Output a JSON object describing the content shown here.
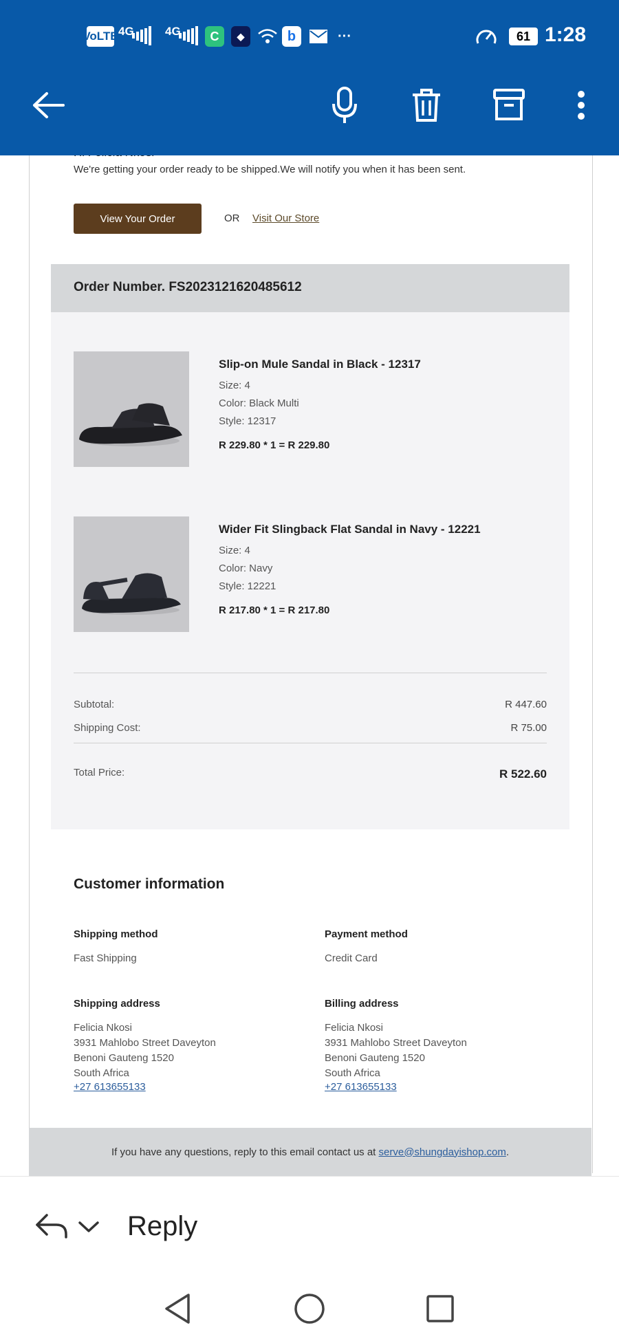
{
  "status_bar": {
    "volte": "VoLTE",
    "net1": "4G",
    "net2": "4G",
    "battery": "61",
    "time": "1:28",
    "more": "···"
  },
  "app_bar": {
    "icons": [
      "back-arrow-icon",
      "microphone-icon",
      "trash-icon",
      "archive-icon",
      "more-vert-icon"
    ],
    "color": "#0859a8"
  },
  "email": {
    "greeting": "Hi Felicia Nkosi",
    "ready_text": "We're getting your order ready to be shipped.We will notify you when it has been sent.",
    "view_order_label": "View Your Order",
    "or_label": "OR",
    "visit_store_label": "Visit Our Store",
    "order_number": "Order Number. FS2023121620485612",
    "products": [
      {
        "title": "Slip-on Mule Sandal in Black - 12317",
        "size": "Size: 4",
        "color": "Color: Black Multi",
        "style": "Style: 12317",
        "price": "R 229.80 * 1 = R 229.80"
      },
      {
        "title": "Wider Fit Slingback Flat Sandal in Navy - 12221",
        "size": "Size: 4",
        "color": "Color: Navy",
        "style": "Style: 12221",
        "price": "R 217.80 * 1 = R 217.80"
      }
    ],
    "summary": {
      "subtotal_label": "Subtotal:",
      "subtotal_value": "R 447.60",
      "shipping_label": "Shipping Cost:",
      "shipping_value": "R 75.00",
      "total_label": "Total Price:",
      "total_value": "R 522.60"
    },
    "customer": {
      "title": "Customer information",
      "shipping_method_label": "Shipping method",
      "shipping_method_value": "Fast Shipping",
      "payment_method_label": "Payment method",
      "payment_method_value": "Credit Card",
      "shipping_address_label": "Shipping address",
      "billing_address_label": "Billing address",
      "address_lines": [
        "Felicia Nkosi",
        "3931 Mahlobo Street Daveyton",
        "Benoni Gauteng 1520",
        "South Africa"
      ],
      "phone": "+27 613655133"
    },
    "footer_text": "If you have any questions, reply to this email contact us at ",
    "footer_email": "serve@shungdayishop.com",
    "footer_end": "."
  },
  "reply_bar": {
    "reply_label": "Reply"
  }
}
